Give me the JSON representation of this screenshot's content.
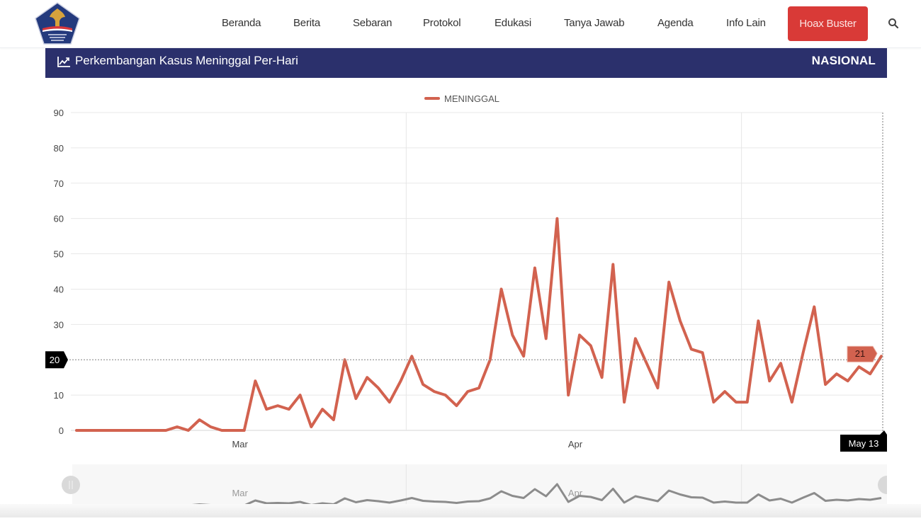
{
  "nav": {
    "items": [
      "Beranda",
      "Berita",
      "Sebaran",
      "Protokol",
      "Edukasi",
      "Tanya Jawab",
      "Agenda",
      "Info Lain"
    ],
    "hoax_button": "Hoax Buster",
    "search_icon": "search-icon",
    "logo": "gugus-tugas-covid19-logo"
  },
  "card": {
    "icon": "line-chart-icon",
    "title": "Perkembangan Kasus Meninggal Per-Hari",
    "region": "NASIONAL"
  },
  "colors": {
    "header_bg": "#2b306c",
    "hoax_bg": "#d93a37",
    "series": "#d2624f",
    "navigator_series": "#8c8c8c"
  },
  "tooltip": {
    "y_label": "20",
    "point_value": "21",
    "x_label": "May 13"
  },
  "navigator": {
    "month_labels": [
      "Mar",
      "Apr"
    ]
  },
  "chart_data": {
    "type": "line",
    "title": "Perkembangan Kasus Meninggal Per-Hari",
    "xlabel": "",
    "ylabel": "",
    "legend": {
      "entries": [
        "MENINGGAL"
      ],
      "placement": "top-center"
    },
    "ylim": [
      0,
      90
    ],
    "yticks": [
      0,
      10,
      20,
      30,
      40,
      50,
      60,
      70,
      80,
      90
    ],
    "xtick_labels": [
      "Mar",
      "Apr"
    ],
    "grid": true,
    "x_start": "2020-03-02",
    "x_end": "2020-05-13",
    "x_month_boundaries": [
      "2020-04-01",
      "2020-05-01"
    ],
    "series": [
      {
        "name": "MENINGGAL",
        "values": [
          0,
          0,
          0,
          0,
          0,
          0,
          0,
          0,
          0,
          1,
          0,
          3,
          1,
          0,
          0,
          0,
          14,
          6,
          7,
          6,
          10,
          1,
          6,
          3,
          20,
          9,
          15,
          12,
          8,
          14,
          21,
          13,
          11,
          10,
          7,
          11,
          12,
          20,
          40,
          27,
          21,
          46,
          26,
          60,
          10,
          27,
          24,
          15,
          47,
          8,
          26,
          19,
          12,
          42,
          31,
          23,
          22,
          8,
          11,
          8,
          8,
          31,
          14,
          19,
          8,
          22,
          35,
          13,
          16,
          14,
          18,
          16,
          21
        ]
      }
    ]
  }
}
